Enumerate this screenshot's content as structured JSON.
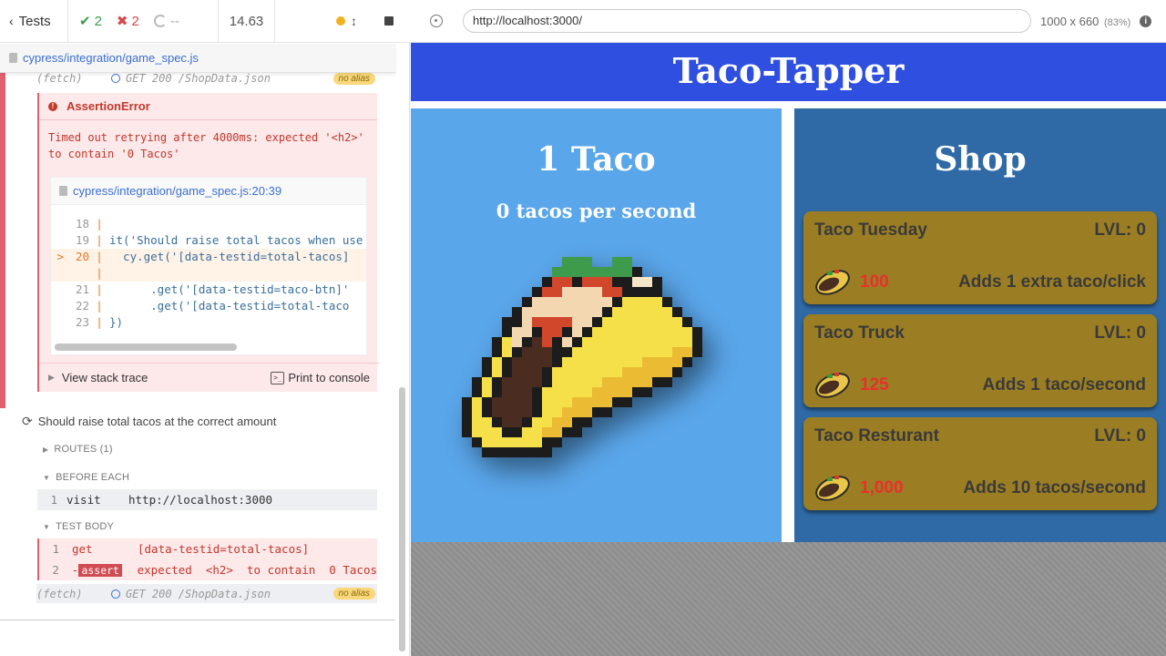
{
  "reporter": {
    "tests_label": "Tests",
    "passed": "2",
    "failed": "2",
    "pending": "--",
    "duration": "14.63",
    "spec_path": "cypress/integration/game_spec.js",
    "fetch_top": {
      "label": "(fetch)",
      "request": "GET 200 /ShopData.json",
      "alias": "no alias"
    },
    "error": {
      "title": "AssertionError",
      "message": "Timed out retrying after 4000ms: expected '<h2>'\nto contain '0 Tacos'",
      "code_file": "cypress/integration/game_spec.js:20:39",
      "code_lines": [
        {
          "marker": "",
          "num": "18",
          "text": "",
          "highlight": false
        },
        {
          "marker": "",
          "num": "19",
          "text": "it('Should raise total tacos when use",
          "highlight": false
        },
        {
          "marker": ">",
          "num": "20",
          "text": "  cy.get('[data-testid=total-tacos]",
          "highlight": true
        },
        {
          "marker": "",
          "num": "",
          "text": "",
          "highlight": true
        },
        {
          "marker": "",
          "num": "21",
          "text": "      .get('[data-testid=taco-btn]'",
          "highlight": false
        },
        {
          "marker": "",
          "num": "22",
          "text": "      .get('[data-testid=total-taco",
          "highlight": false
        },
        {
          "marker": "",
          "num": "23",
          "text": "})",
          "highlight": false
        }
      ],
      "stack_trace": "View stack trace",
      "print": "Print to console"
    },
    "test2_title": "Should raise total tacos at the correct amount",
    "routes": "ROUTES (1)",
    "before_each": "BEFORE EACH",
    "visit": {
      "n": "1",
      "cmd": "visit",
      "arg": "http://localhost:3000"
    },
    "test_body": "TEST BODY",
    "body_rows": [
      {
        "n": "1",
        "cmd": "get",
        "arg": "[data-testid=total-tacos]"
      },
      {
        "n": "2",
        "cmd": "assert",
        "arg": "expected  <h2>  to contain  0 Tacos"
      }
    ],
    "fetch_bottom": {
      "label": "(fetch)",
      "request": "GET 200 /ShopData.json",
      "alias": "no alias"
    }
  },
  "browser": {
    "url": "http://localhost:3000/",
    "viewport": "1000 x 660",
    "scale": "(83%)"
  },
  "app": {
    "title": "Taco-Tapper",
    "taco_count": "1 Taco",
    "tacos_per_second": "0 tacos per second",
    "shop_title": "Shop",
    "items": [
      {
        "name": "Taco Tuesday",
        "level": "LVL: 0",
        "price": "100",
        "desc": "Adds 1 extra taco/click"
      },
      {
        "name": "Taco Truck",
        "level": "LVL: 0",
        "price": "125",
        "desc": "Adds 1 taco/second"
      },
      {
        "name": "Taco Resturant",
        "level": "LVL: 0",
        "price": "1,000",
        "desc": "Adds 10 tacos/second"
      }
    ]
  },
  "colors": {
    "header_blue": "#2e4fe0",
    "taco_panel": "#5aa6ea",
    "shop_panel": "#2f6aa6",
    "shop_item": "#9b7e23",
    "price_red": "#e8302c",
    "pass_green": "#3c9b4f",
    "fail_red": "#d44a4a"
  }
}
